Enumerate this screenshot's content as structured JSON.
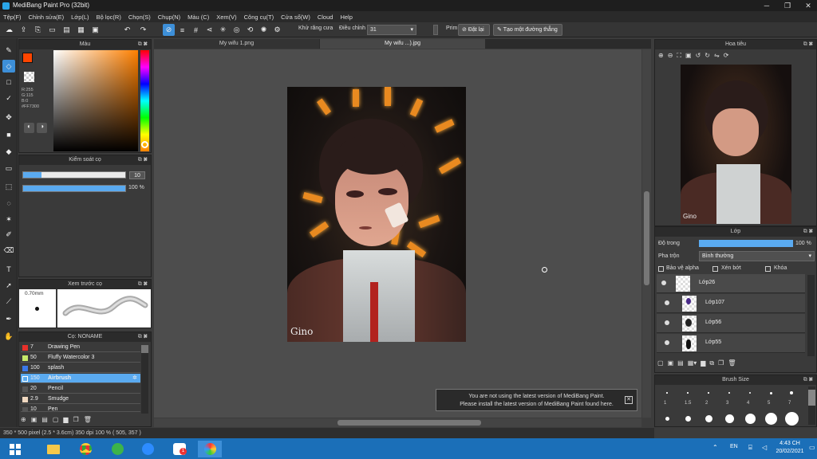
{
  "window": {
    "title": "MediBang Paint Pro (32bit)"
  },
  "menu": [
    "Tệp(F)",
    "Chỉnh sửa(E)",
    "Lớp(L)",
    "Bộ lọc(R)",
    "Chọn(S)",
    "Chụp(N)",
    "Màu (C)",
    "Xem(V)",
    "Công cụ(T)",
    "Cửa sổ(W)",
    "Cloud",
    "Help"
  ],
  "toolbar": {
    "antialias_label": "Khử răng cưa",
    "adjust_label": "Điều chỉnh",
    "adjust_value": "31",
    "prime_label": "Prim",
    "reset_label": "Đặt lại",
    "make_line_label": "Tạo một đường thẳng"
  },
  "color_panel": {
    "title": "Màu",
    "fg_color": "#ff4500",
    "readout_r": "R:255",
    "readout_g": "G:115",
    "readout_b": "B:0",
    "hex": "#FF7300"
  },
  "brush_control": {
    "title": "Kiểm soát cọ",
    "size_value": "10",
    "opacity_value": "100 %",
    "opacity": 1.0
  },
  "brush_preview": {
    "title": "Xem trước cọ",
    "size_text": "0.70mm"
  },
  "brush_list": {
    "title": "Cọ: NONAME",
    "items": [
      {
        "size": "7",
        "name": "Drawing Pen",
        "color": "#e8302a"
      },
      {
        "size": "50",
        "name": "Fluffy Watercolor 3",
        "color": "#c6e86a"
      },
      {
        "size": "100",
        "name": "splash",
        "color": "#3a78e8"
      },
      {
        "size": "150",
        "name": "Airbrush",
        "color": "#5aaaf0"
      },
      {
        "size": "20",
        "name": "Pencil",
        "color": "#555555"
      },
      {
        "size": "2.9",
        "name": "Smudge",
        "color": "#f0d8c0"
      },
      {
        "size": "10",
        "name": "Pen",
        "color": "#555555"
      }
    ]
  },
  "tabs": [
    "My wifu 1.png",
    "My wifu ...).jpg"
  ],
  "canvas": {
    "signature": "Gino"
  },
  "notification": {
    "line1": "You are not using the latest version of MediBang Paint.",
    "line2": "Please install the latest version of MediBang Paint found here."
  },
  "navigator": {
    "title": "Hoa tiêu"
  },
  "layers_panel": {
    "title": "Lớp",
    "opacity_label": "Độ trong",
    "opacity_value": "100 %",
    "blend_label": "Pha trộn",
    "blend_value": "Bình thường",
    "protect_alpha": "Bảo vệ alpha",
    "clipping": "Xén bớt",
    "lock": "Khóa",
    "layers": [
      "Lớp26",
      "Lớp107",
      "Lớp56",
      "Lớp55"
    ]
  },
  "brush_size": {
    "title": "Brush Size",
    "row1": [
      "1",
      "1.5",
      "2",
      "3",
      "4",
      "5",
      "7"
    ]
  },
  "status": {
    "text": "350 * 500 pixel  (2.5 * 3.6cm)  350 dpi  100 %  ( 505, 357 )"
  },
  "taskbar": {
    "lang": "EN",
    "time": "4:43 CH",
    "date": "20/02/2021",
    "zalo_badge": "1"
  }
}
